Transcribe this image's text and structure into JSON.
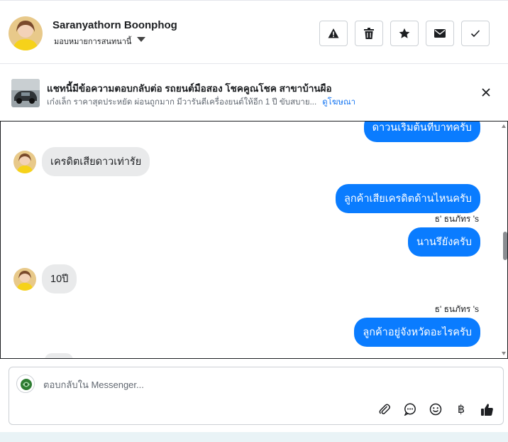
{
  "header": {
    "contact_name": "Saranyathorn Boonphog",
    "assign_label": "มอบหมายการสนทนานี้",
    "actions": [
      {
        "name": "report-spam-button",
        "icon": "warning-icon"
      },
      {
        "name": "delete-button",
        "icon": "trash-icon"
      },
      {
        "name": "star-button",
        "icon": "star-icon"
      },
      {
        "name": "mark-unread-button",
        "icon": "envelope-icon"
      },
      {
        "name": "mark-done-button",
        "icon": "check-icon"
      }
    ]
  },
  "ad_banner": {
    "title": "แชทนี้มีข้อความตอบกลับต่อ รถยนต์มือสอง โชคคูณโชค สาขาบ้านผือ",
    "subtitle": "เก๋งเล็ก ราคาสุดประหยัด ผ่อนถูกมาก มีวารันตีเครื่องยนต์ให้อีก 1 ปี ขับสบาย...",
    "link": "ดูโฆษณา"
  },
  "thread": {
    "messages": [
      {
        "dir": "out",
        "text": "ดาวนเริ่มต้นที่บาทครับ"
      },
      {
        "dir": "in",
        "text": "เครดิตเสียดาวเท่ารัย"
      },
      {
        "dir": "out",
        "text": "ลูกค้าเสียเครดิตด้านไหนครับ"
      },
      {
        "dir": "out",
        "sender": "ธ' ธนภัทร 's",
        "text": "นานรึยังครับ"
      },
      {
        "dir": "in",
        "text": "10ปี"
      },
      {
        "dir": "out",
        "sender": "ธ' ธนภัทร 's",
        "text": "ลูกค้าอยู่จังหวัดอะไรครับ"
      }
    ]
  },
  "composer": {
    "placeholder": "ตอบกลับใน Messenger...",
    "tools": [
      "attachment-icon",
      "chat-bubble-icon",
      "emoji-icon",
      "baht-icon",
      "thumbs-up-icon"
    ],
    "baht_symbol": "฿"
  },
  "colors": {
    "accent": "#0a7cff",
    "incoming_bubble": "#e9eaeb",
    "link": "#1877f2"
  }
}
